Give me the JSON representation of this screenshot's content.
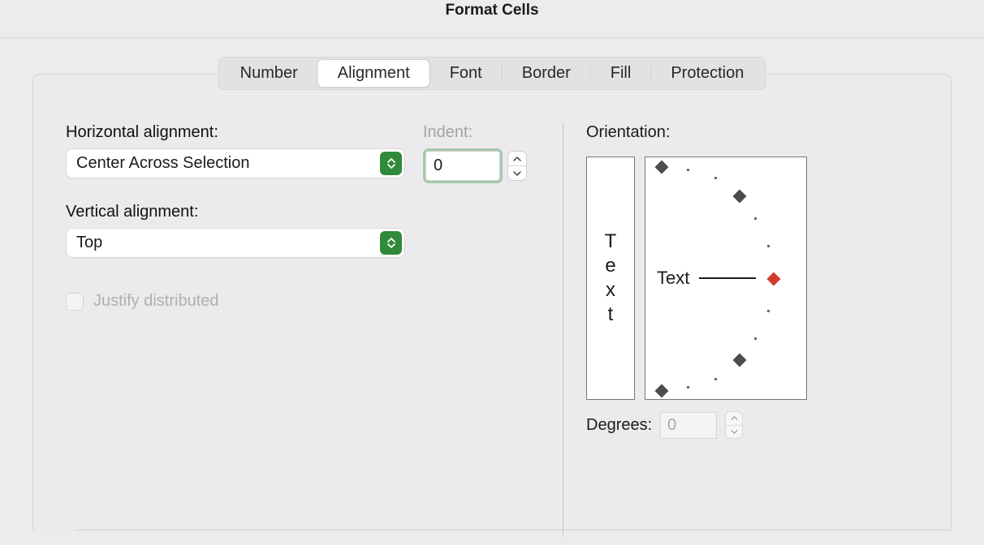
{
  "window": {
    "title": "Format Cells"
  },
  "tabs": {
    "number": "Number",
    "alignment": "Alignment",
    "font": "Font",
    "border": "Border",
    "fill": "Fill",
    "protection": "Protection",
    "active": "alignment"
  },
  "alignment": {
    "horizontal_label": "Horizontal alignment:",
    "horizontal_value": "Center Across Selection",
    "indent_label": "Indent:",
    "indent_value": "0",
    "vertical_label": "Vertical alignment:",
    "vertical_value": "Top",
    "justify_distributed_label": "Justify distributed",
    "justify_distributed_checked": false,
    "justify_distributed_enabled": false
  },
  "orientation": {
    "label": "Orientation:",
    "vertical_text": [
      "T",
      "e",
      "x",
      "t"
    ],
    "dial_text": "Text",
    "degrees_label": "Degrees:",
    "degrees_value": "0",
    "degrees_enabled": false
  }
}
